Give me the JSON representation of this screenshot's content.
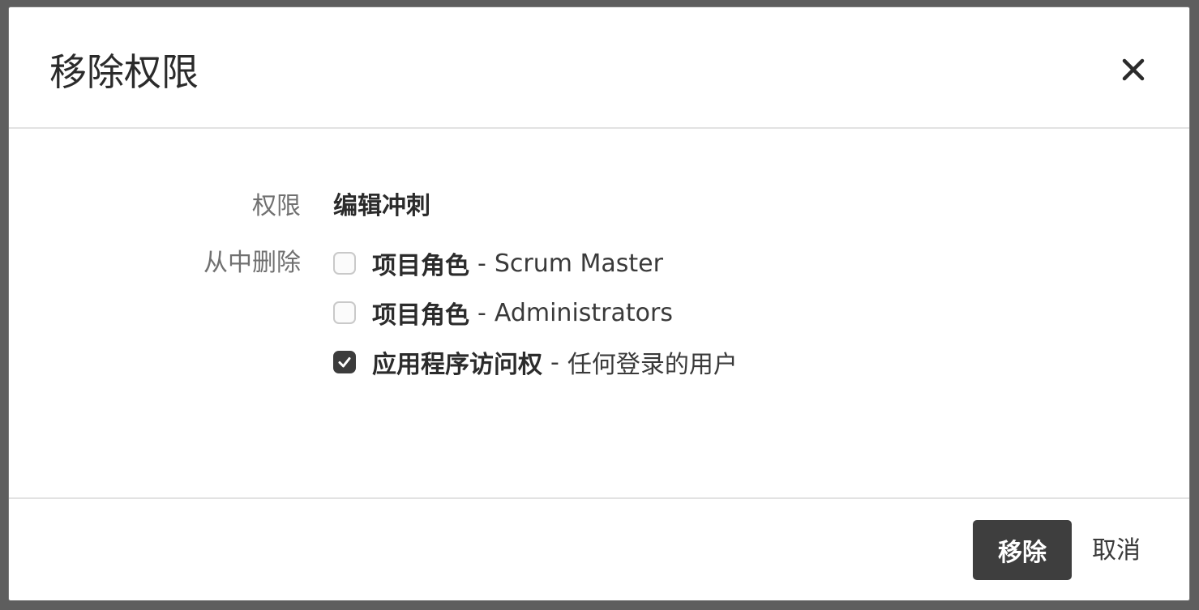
{
  "dialog": {
    "title": "移除权限",
    "close_icon": "close-icon"
  },
  "body": {
    "permission_label": "权限",
    "permission_value": "编辑冲刺",
    "remove_from_label": "从中删除",
    "options": [
      {
        "type": "项目角色",
        "separator": "-",
        "name": "Scrum Master",
        "checked": false
      },
      {
        "type": "项目角色",
        "separator": "-",
        "name": "Administrators",
        "checked": false
      },
      {
        "type": "应用程序访问权",
        "separator": "-",
        "name": "任何登录的用户",
        "checked": true
      }
    ]
  },
  "footer": {
    "remove_label": "移除",
    "cancel_label": "取消"
  },
  "colors": {
    "primary_button": "#3e3e3e",
    "checkbox_checked": "#3c3c3c"
  }
}
